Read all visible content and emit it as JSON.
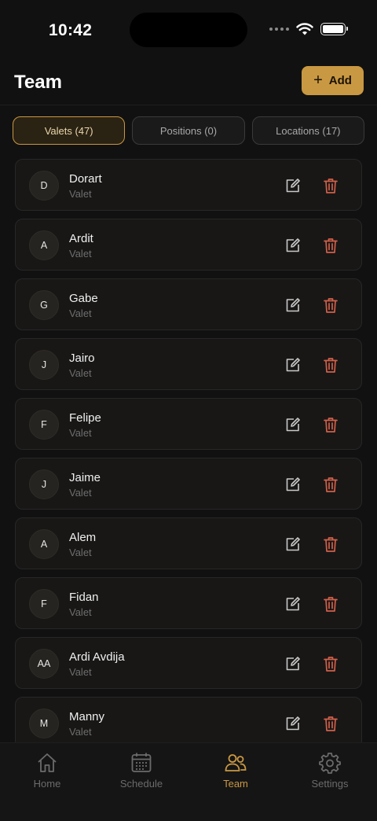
{
  "status_bar": {
    "time": "10:42"
  },
  "header": {
    "title": "Team",
    "add_label": "Add",
    "add_icon": "plus-icon"
  },
  "tabs": [
    {
      "label": "Valets (47)",
      "active": true
    },
    {
      "label": "Positions (0)",
      "active": false
    },
    {
      "label": "Locations (17)",
      "active": false
    }
  ],
  "members": [
    {
      "initials": "D",
      "name": "Dorart",
      "role": "Valet"
    },
    {
      "initials": "A",
      "name": "Ardit",
      "role": "Valet"
    },
    {
      "initials": "G",
      "name": "Gabe",
      "role": "Valet"
    },
    {
      "initials": "J",
      "name": "Jairo",
      "role": "Valet"
    },
    {
      "initials": "F",
      "name": "Felipe",
      "role": "Valet"
    },
    {
      "initials": "J",
      "name": "Jaime",
      "role": "Valet"
    },
    {
      "initials": "A",
      "name": "Alem",
      "role": "Valet"
    },
    {
      "initials": "F",
      "name": "Fidan",
      "role": "Valet"
    },
    {
      "initials": "AA",
      "name": "Ardi Avdija",
      "role": "Valet"
    },
    {
      "initials": "M",
      "name": "Manny",
      "role": "Valet"
    }
  ],
  "bottom_nav": [
    {
      "label": "Home",
      "icon": "home-icon",
      "active": false
    },
    {
      "label": "Schedule",
      "icon": "calendar-icon",
      "active": false
    },
    {
      "label": "Team",
      "icon": "team-icon",
      "active": true
    },
    {
      "label": "Settings",
      "icon": "gear-icon",
      "active": false
    }
  ],
  "colors": {
    "accent": "#c99842",
    "delete": "#d0604a",
    "background": "#111111"
  }
}
